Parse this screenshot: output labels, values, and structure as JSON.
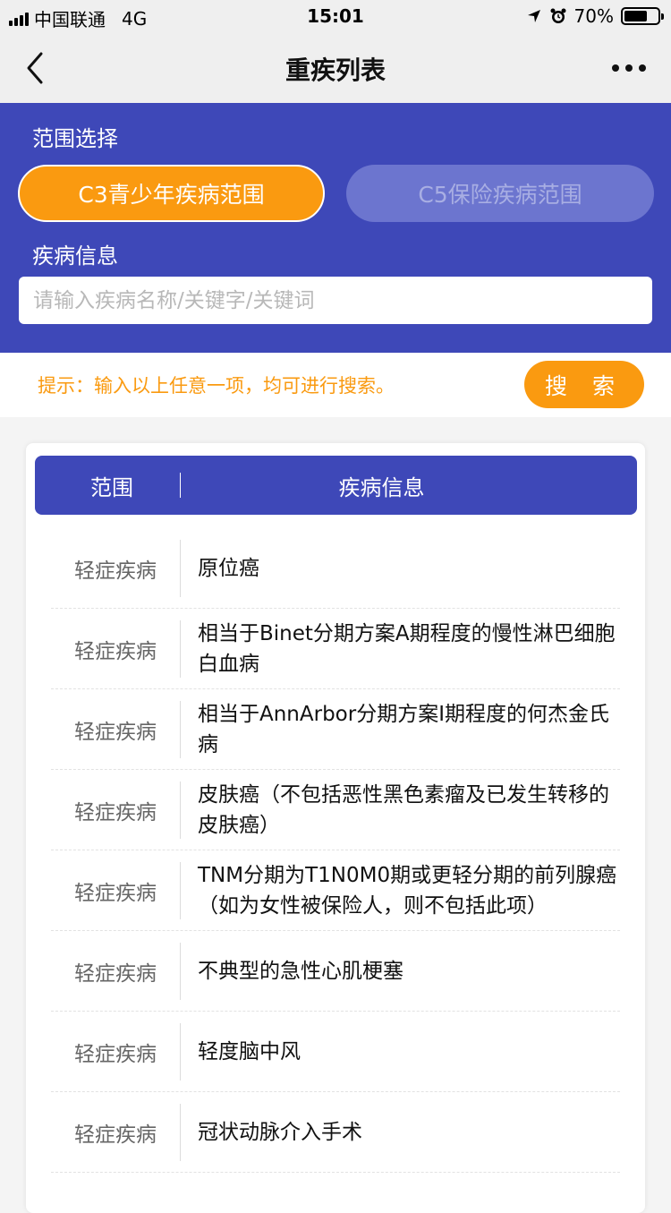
{
  "status": {
    "carrier": "中国联通",
    "network": "4G",
    "time": "15:01",
    "battery": "70%",
    "battery_level": 0.7
  },
  "nav": {
    "title": "重疾列表"
  },
  "filter": {
    "range_label": "范围选择",
    "range_options": [
      "C3青少年疾病范围",
      "C5保险疾病范围"
    ],
    "selected_range": "C3青少年疾病范围",
    "info_label": "疾病信息",
    "search_placeholder": "请输入疾病名称/关键字/关键词",
    "search_value": ""
  },
  "hint": {
    "text": "提示：输入以上任意一项，均可进行搜索。",
    "search_label": "搜 索"
  },
  "table": {
    "headers": [
      "范围",
      "疾病信息"
    ],
    "rows": [
      {
        "category": "轻症疾病",
        "name": "原位癌"
      },
      {
        "category": "轻症疾病",
        "name": "相当于Binet分期方案A期程度的慢性淋巴细胞白血病"
      },
      {
        "category": "轻症疾病",
        "name": "相当于AnnArbor分期方案I期程度的何杰金氏病"
      },
      {
        "category": "轻症疾病",
        "name": "皮肤癌（不包括恶性黑色素瘤及已发生转移的皮肤癌）"
      },
      {
        "category": "轻症疾病",
        "name": "TNM分期为T1N0M0期或更轻分期的前列腺癌（如为女性被保险人，则不包括此项）"
      },
      {
        "category": "轻症疾病",
        "name": "不典型的急性心肌梗塞"
      },
      {
        "category": "轻症疾病",
        "name": "轻度脑中风"
      },
      {
        "category": "轻症疾病",
        "name": "冠状动脉介入手术"
      }
    ]
  },
  "colors": {
    "primary": "#3e48b8",
    "accent": "#fa9a10"
  }
}
